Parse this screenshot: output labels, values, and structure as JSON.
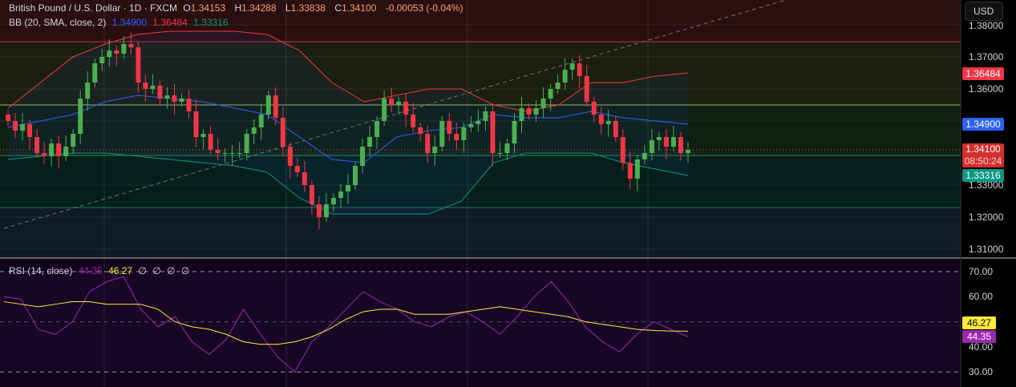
{
  "header": {
    "symbol": "British Pound / U.S. Dollar · 1D · FXCM",
    "open_label": "O",
    "open": "1.34153",
    "high_label": "H",
    "high": "1.34288",
    "low_label": "L",
    "low": "1.33838",
    "close_label": "C",
    "close": "1.34100",
    "change": "-0.00053 (-0.04%)"
  },
  "bb": {
    "label": "BB (20, SMA, close, 2)",
    "basis": "1.34900",
    "upper": "1.36484",
    "lower": "1.33316"
  },
  "rsi": {
    "label": "RSI (14, close)",
    "value": "44.35",
    "ma": "46.27",
    "extras": [
      "∅",
      "∅",
      "∅",
      "∅"
    ]
  },
  "currency_button": "USD",
  "price_axis": [
    "1.38000",
    "1.37000",
    "1.36000",
    "1.33000",
    "1.32000",
    "1.31000"
  ],
  "price_tags": {
    "upper": "1.36484",
    "basis": "1.34900",
    "last": "1.34100",
    "countdown": "08:50:24",
    "lower": "1.33316"
  },
  "rsi_axis": [
    "70.00",
    "60.00",
    "40.00",
    "30.00"
  ],
  "rsi_tags": {
    "ma": "46.27",
    "rsi": "44.35"
  },
  "colors": {
    "up": "#26a69a",
    "down": "#ef5350",
    "upper": "#f23645",
    "basis": "#2962ff",
    "lower": "#089981",
    "rsi": "#9c27b0",
    "rsi_ma": "#ffeb3b"
  },
  "chart_data": {
    "type": "candlestick",
    "closes": [
      1.35,
      1.347,
      1.349,
      1.345,
      1.34,
      1.339,
      1.343,
      1.339,
      1.342,
      1.346,
      1.357,
      1.362,
      1.368,
      1.37,
      1.372,
      1.371,
      1.374,
      1.373,
      1.362,
      1.36,
      1.361,
      1.357,
      1.358,
      1.356,
      1.357,
      1.353,
      1.345,
      1.346,
      1.341,
      1.34,
      1.34,
      1.34,
      1.34,
      1.346,
      1.348,
      1.352,
      1.358,
      1.351,
      1.342,
      1.336,
      1.334,
      1.33,
      1.324,
      1.32,
      1.324,
      1.326,
      1.328,
      1.33,
      1.336,
      1.342,
      1.345,
      1.35,
      1.357,
      1.355,
      1.356,
      1.352,
      1.348,
      1.346,
      1.34,
      1.342,
      1.35,
      1.346,
      1.344,
      1.348,
      1.349,
      1.35,
      1.353,
      1.34,
      1.34,
      1.343,
      1.35,
      1.354,
      1.352,
      1.354,
      1.357,
      1.36,
      1.362,
      1.366,
      1.368,
      1.364,
      1.356,
      1.352,
      1.349,
      1.35,
      1.345,
      1.337,
      1.332,
      1.338,
      1.34,
      1.344,
      1.345,
      1.342,
      1.345,
      1.34,
      1.341
    ],
    "bb_upper": [
      1.354,
      1.362,
      1.37,
      1.374,
      1.377,
      1.378,
      1.378,
      1.378,
      1.377,
      1.372,
      1.362,
      1.356,
      1.358,
      1.36,
      1.36,
      1.355,
      1.353,
      1.355,
      1.362,
      1.362,
      1.364,
      1.365
    ],
    "bb_basis": [
      1.348,
      1.35,
      1.352,
      1.356,
      1.358,
      1.357,
      1.356,
      1.354,
      1.352,
      1.345,
      1.338,
      1.337,
      1.345,
      1.347,
      1.348,
      1.352,
      1.351,
      1.351,
      1.353,
      1.351,
      1.35,
      1.349
    ],
    "bb_lower": [
      1.338,
      1.339,
      1.34,
      1.34,
      1.339,
      1.338,
      1.337,
      1.336,
      1.334,
      1.326,
      1.321,
      1.321,
      1.321,
      1.321,
      1.325,
      1.337,
      1.34,
      1.34,
      1.34,
      1.337,
      1.335,
      1.333
    ],
    "rsi_values": [
      60,
      59,
      47,
      45,
      50,
      62,
      66,
      68,
      55,
      48,
      52,
      42,
      37,
      43,
      55,
      45,
      36,
      30,
      42,
      48,
      55,
      62,
      58,
      55,
      50,
      48,
      52,
      54,
      50,
      45,
      52,
      60,
      66,
      58,
      48,
      42,
      38,
      45,
      50,
      47,
      44
    ],
    "rsi_ma": [
      58,
      57,
      56,
      57,
      58,
      58,
      57,
      57,
      57,
      55,
      50,
      48,
      47,
      45,
      42,
      41,
      41,
      42,
      44,
      47,
      51,
      54,
      55,
      55,
      53,
      53,
      53,
      54,
      55,
      56,
      55,
      54,
      53,
      52,
      50,
      49,
      48,
      47,
      46.5,
      46.3,
      46.27
    ],
    "price_range": [
      1.305,
      1.3875
    ],
    "rsi_range": [
      25,
      80
    ]
  }
}
